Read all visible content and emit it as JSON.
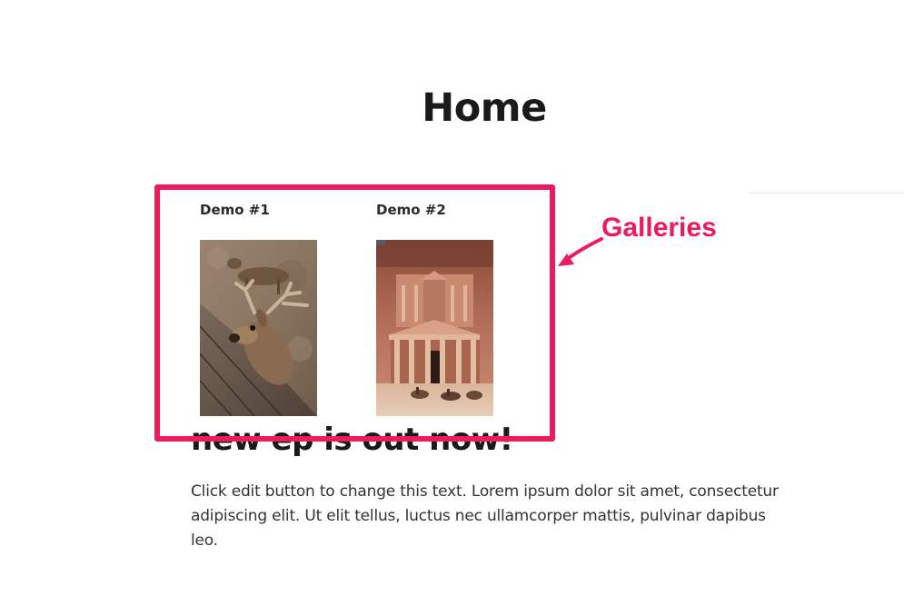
{
  "page": {
    "title": "Home"
  },
  "galleries": [
    {
      "title": "Demo #1",
      "image_alt": "deer-photo"
    },
    {
      "title": "Demo #2",
      "image_alt": "petra-treasury-photo"
    }
  ],
  "post": {
    "headline": "new ep is out now!",
    "body": "Click edit button to change this text. Lorem ipsum dolor sit amet, consectetur adipiscing elit. Ut elit tellus, luctus nec ullamcorper mattis, pulvinar dapibus leo."
  },
  "annotation": {
    "label": "Galleries",
    "color": "#ee1a5e"
  }
}
